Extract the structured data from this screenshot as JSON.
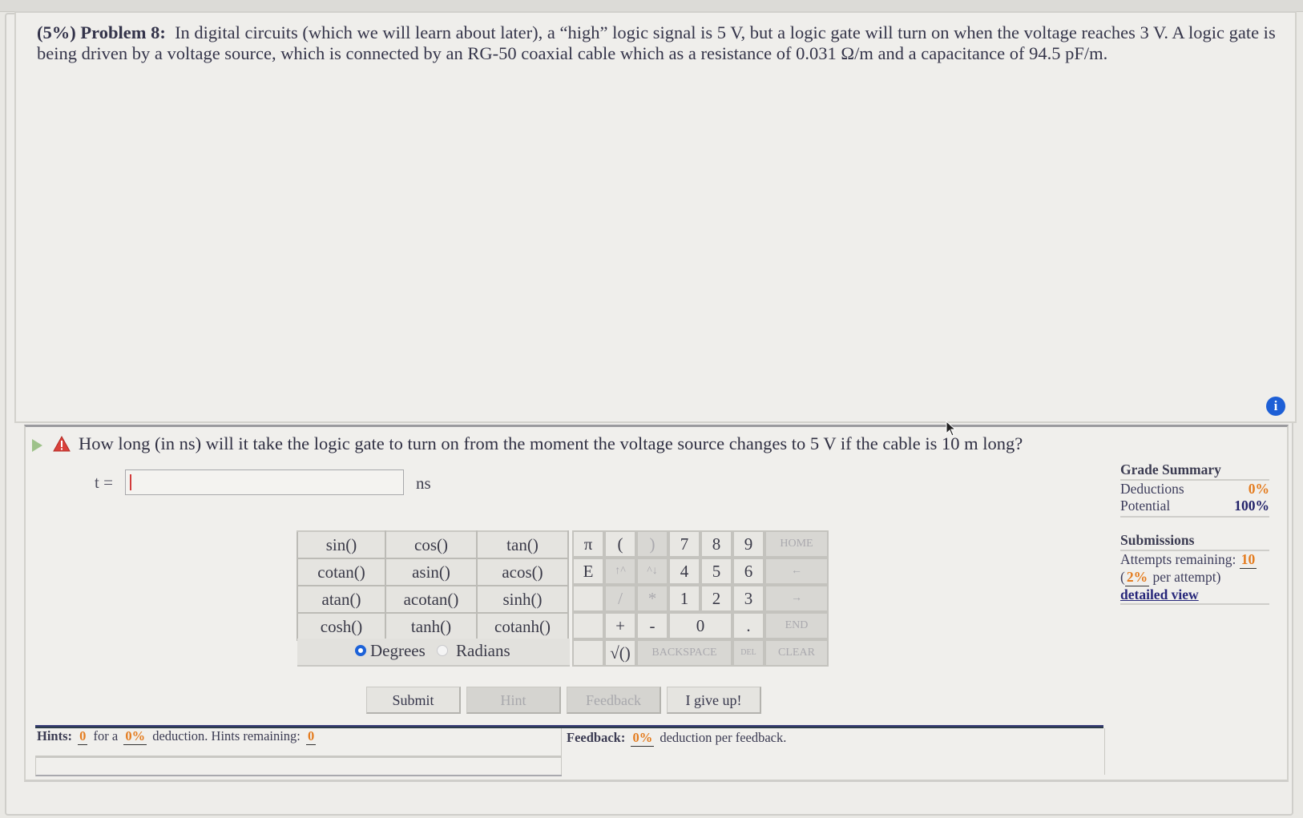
{
  "problem": {
    "weight": "(5%)",
    "label": "Problem 8:",
    "text": "In digital circuits (which we will learn about later), a “high” logic signal is 5 V, but a logic gate will turn on when the voltage reaches 3 V. A logic gate is being driven by a voltage source, which is connected by an RG-50 coaxial cable which as a resistance of 0.031 Ω/m and a capacitance of 94.5 pF/m."
  },
  "part": {
    "question": "How long (in ns) will it take the logic gate to turn on from the moment the voltage source changes to 5 V if the cable is 10 m long?",
    "variable_label": "t =",
    "answer_value": "",
    "unit": "ns",
    "icons": {
      "expand": "play-triangle-icon",
      "status": "warning-icon",
      "info": "info-icon"
    },
    "info_glyph": "i"
  },
  "functions": [
    [
      "sin()",
      "cos()",
      "tan()"
    ],
    [
      "cotan()",
      "asin()",
      "acos()"
    ],
    [
      "atan()",
      "acotan()",
      "sinh()"
    ],
    [
      "cosh()",
      "tanh()",
      "cotanh()"
    ]
  ],
  "angle_mode": {
    "degrees": "Degrees",
    "radians": "Radians",
    "selected": "Degrees"
  },
  "keypad": {
    "pi": "π",
    "e": "E",
    "open_paren": "(",
    "close_paren": ")",
    "up_caret": "↑^",
    "down_caret": "^↓",
    "divide": "/",
    "multiply": "*",
    "plus": "+",
    "minus": "-",
    "sqrt": "√()",
    "digits": [
      "7",
      "8",
      "9",
      "4",
      "5",
      "6",
      "1",
      "2",
      "3",
      "0"
    ],
    "dot": ".",
    "home": "HOME",
    "left": "←",
    "right": "→",
    "end": "END",
    "backspace": "BACKSPACE",
    "del": "DEL",
    "clear": "CLEAR"
  },
  "buttons": {
    "submit": "Submit",
    "hint": "Hint",
    "feedback": "Feedback",
    "give_up": "I give up!"
  },
  "hints": {
    "label": "Hints:",
    "count": "0",
    "for_a": "for a",
    "pct": "0%",
    "deduction_text": "deduction. Hints remaining:",
    "remaining": "0"
  },
  "feedback": {
    "label": "Feedback:",
    "pct": "0%",
    "text": "deduction per feedback."
  },
  "grade_summary": {
    "title": "Grade Summary",
    "deductions_label": "Deductions",
    "deductions_value": "0%",
    "potential_label": "Potential",
    "potential_value": "100%"
  },
  "submissions": {
    "title": "Submissions",
    "attempts_label": "Attempts remaining:",
    "attempts_value": "10",
    "per_attempt_pct": "2%",
    "per_attempt_text": "per attempt)",
    "detailed_view": "detailed view"
  }
}
